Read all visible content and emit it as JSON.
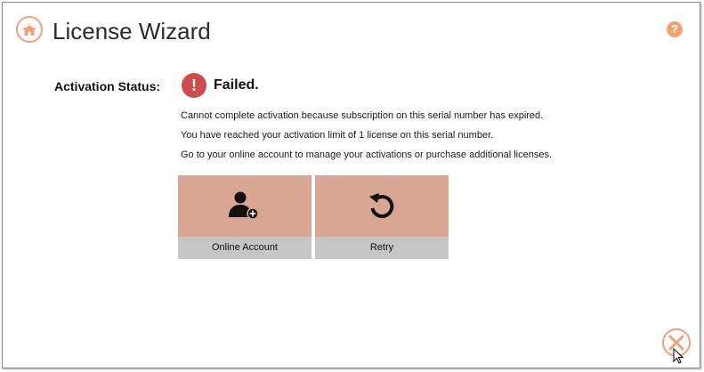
{
  "window": {
    "title": "License Wizard",
    "help_label": "?",
    "home_icon": "home-icon",
    "close_icon": "close-icon"
  },
  "status": {
    "label": "Activation Status:",
    "icon_glyph": "!",
    "value": "Failed."
  },
  "messages": [
    "Cannot complete activation because subscription on this serial number has expired.",
    "You have reached your activation limit of 1 license on this serial number.",
    "Go to your online account to manage your activations or purchase additional licenses."
  ],
  "actions": [
    {
      "label": "Online Account",
      "icon": "add-user-icon"
    },
    {
      "label": "Retry",
      "icon": "retry-icon"
    }
  ],
  "colors": {
    "accent": "#f0a07a",
    "error": "#cf4c4c",
    "tile_bg": "#d8a692",
    "tile_label_bg": "#c6c6c6"
  }
}
